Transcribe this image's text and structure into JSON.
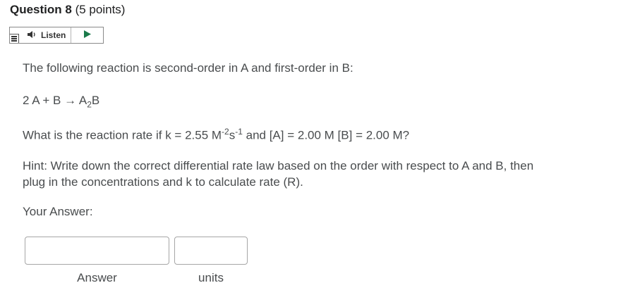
{
  "question": {
    "title": "Question 8",
    "points": "(5 points)"
  },
  "listen": {
    "label": "Listen",
    "icons": [
      "menu-icon",
      "speaker-icon",
      "play-icon"
    ]
  },
  "body": {
    "intro": "The following reaction is second-order in A and first-order in B:",
    "reaction": {
      "lhs": "2 A + B → A",
      "product_sub": "2",
      "product_tail": "B"
    },
    "rate_question": {
      "prefix": "What is the reaction rate if k = 2.55  M",
      "m_exp": "-2",
      "s": "s",
      "s_exp": "-1",
      "suffix": " and [A] = 2.00 M [B] = 2.00 M?"
    },
    "hint": "Hint: Write down the correct differential rate law based on the order with respect to A and B, then plug in the concentrations and k to calculate rate (R).",
    "your_answer": "Your Answer:"
  },
  "answer": {
    "value_field": "",
    "units_field": "",
    "value_label": "Answer",
    "units_label": "units"
  }
}
